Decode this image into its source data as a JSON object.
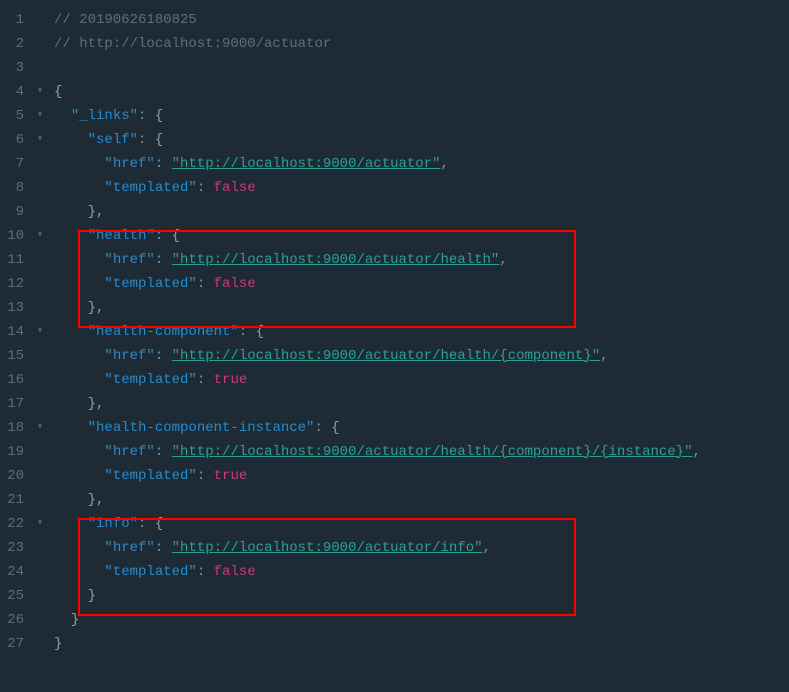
{
  "lines": {
    "l1_comment": "// 20190626180825",
    "l2_comment": "// http://localhost:9000/actuator",
    "l4_brace": "{",
    "l5_key": "\"_links\"",
    "l5_colon": ": ",
    "l5_brace": "{",
    "l6_key": "\"self\"",
    "l6_colon": ": ",
    "l6_brace": "{",
    "l7_key": "\"href\"",
    "l7_colon": ": ",
    "l7_val": "\"http://localhost:9000/actuator\"",
    "l7_comma": ",",
    "l8_key": "\"templated\"",
    "l8_colon": ": ",
    "l8_val": "false",
    "l9_brace": "},",
    "l10_key": "\"health\"",
    "l10_colon": ": ",
    "l10_brace": "{",
    "l11_key": "\"href\"",
    "l11_colon": ": ",
    "l11_val": "\"http://localhost:9000/actuator/health\"",
    "l11_comma": ",",
    "l12_key": "\"templated\"",
    "l12_colon": ": ",
    "l12_val": "false",
    "l13_brace": "},",
    "l14_key": "\"health-component\"",
    "l14_colon": ": ",
    "l14_brace": "{",
    "l15_key": "\"href\"",
    "l15_colon": ": ",
    "l15_val": "\"http://localhost:9000/actuator/health/{component}\"",
    "l15_comma": ",",
    "l16_key": "\"templated\"",
    "l16_colon": ": ",
    "l16_val": "true",
    "l17_brace": "},",
    "l18_key": "\"health-component-instance\"",
    "l18_colon": ": ",
    "l18_brace": "{",
    "l19_key": "\"href\"",
    "l19_colon": ": ",
    "l19_val": "\"http://localhost:9000/actuator/health/{component}/{instance}\"",
    "l19_comma": ",",
    "l20_key": "\"templated\"",
    "l20_colon": ": ",
    "l20_val": "true",
    "l21_brace": "},",
    "l22_key": "\"info\"",
    "l22_colon": ": ",
    "l22_brace": "{",
    "l23_key": "\"href\"",
    "l23_colon": ": ",
    "l23_val": "\"http://localhost:9000/actuator/info\"",
    "l23_comma": ",",
    "l24_key": "\"templated\"",
    "l24_colon": ": ",
    "l24_val": "false",
    "l25_brace": "}",
    "l26_brace": "}",
    "l27_brace": "}"
  },
  "nums": {
    "n1": "1",
    "n2": "2",
    "n3": "3",
    "n4": "4",
    "n5": "5",
    "n6": "6",
    "n7": "7",
    "n8": "8",
    "n9": "9",
    "n10": "10",
    "n11": "11",
    "n12": "12",
    "n13": "13",
    "n14": "14",
    "n15": "15",
    "n16": "16",
    "n17": "17",
    "n18": "18",
    "n19": "19",
    "n20": "20",
    "n21": "21",
    "n22": "22",
    "n23": "23",
    "n24": "24",
    "n25": "25",
    "n26": "26",
    "n27": "27"
  },
  "fold": "▾"
}
